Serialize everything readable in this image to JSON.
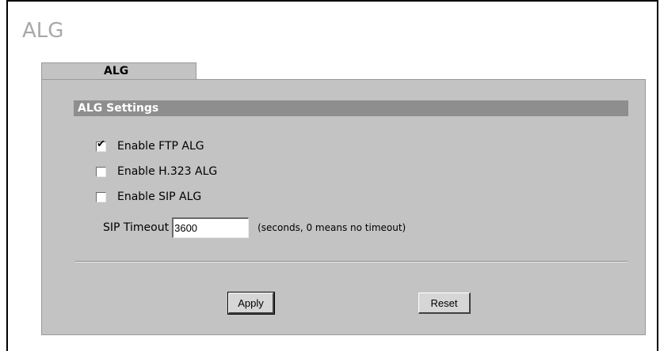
{
  "page": {
    "title": "ALG"
  },
  "tabs": [
    {
      "label": "ALG",
      "active": true
    }
  ],
  "section": {
    "header": "ALG Settings"
  },
  "options": [
    {
      "label": "Enable FTP ALG",
      "checked": true
    },
    {
      "label": "Enable H.323 ALG",
      "checked": false
    },
    {
      "label": "Enable SIP ALG",
      "checked": false
    }
  ],
  "sip_timeout": {
    "label": "SIP Timeout",
    "value": "3600",
    "hint": "(seconds, 0 means no timeout)"
  },
  "buttons": {
    "apply": "Apply",
    "reset": "Reset"
  }
}
